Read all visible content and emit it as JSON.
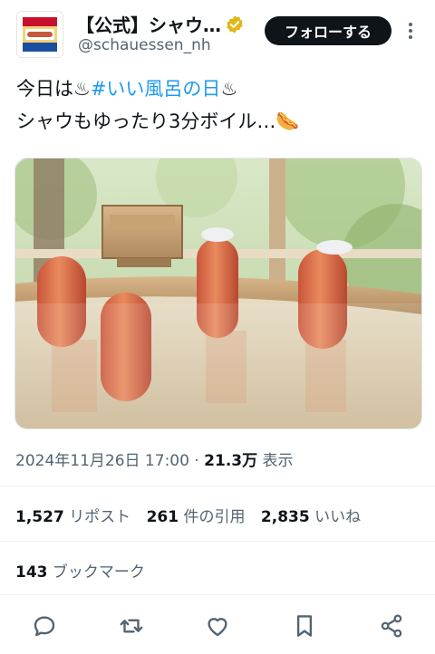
{
  "account": {
    "display_name": "【公式】シャウ…",
    "handle": "@schauessen_nh",
    "verified": true,
    "avatar_text": "シャウエッセン"
  },
  "follow_label": "フォローする",
  "tweet": {
    "line1_prefix": "今日は♨",
    "hashtag": "#いい風呂の日",
    "line1_suffix": "♨",
    "line2": "シャウもゆったり3分ボイル…🌭"
  },
  "meta": {
    "datetime": "2024年11月26日 17:00",
    "separator": " · ",
    "views_count": "21.3万",
    "views_label": " 表示"
  },
  "stats": {
    "reposts_count": "1,527",
    "reposts_label": "リポスト",
    "quotes_count": "261",
    "quotes_label": "件の引用",
    "likes_count": "2,835",
    "likes_label": "いいね",
    "bookmarks_count": "143",
    "bookmarks_label": "ブックマーク"
  },
  "colors": {
    "accent": "#1d9bf0",
    "text": "#0f1419",
    "muted": "#536471",
    "verified_gold": "#e2b719"
  },
  "actions": [
    "reply-icon",
    "repost-icon",
    "like-icon",
    "bookmark-icon",
    "share-icon"
  ]
}
